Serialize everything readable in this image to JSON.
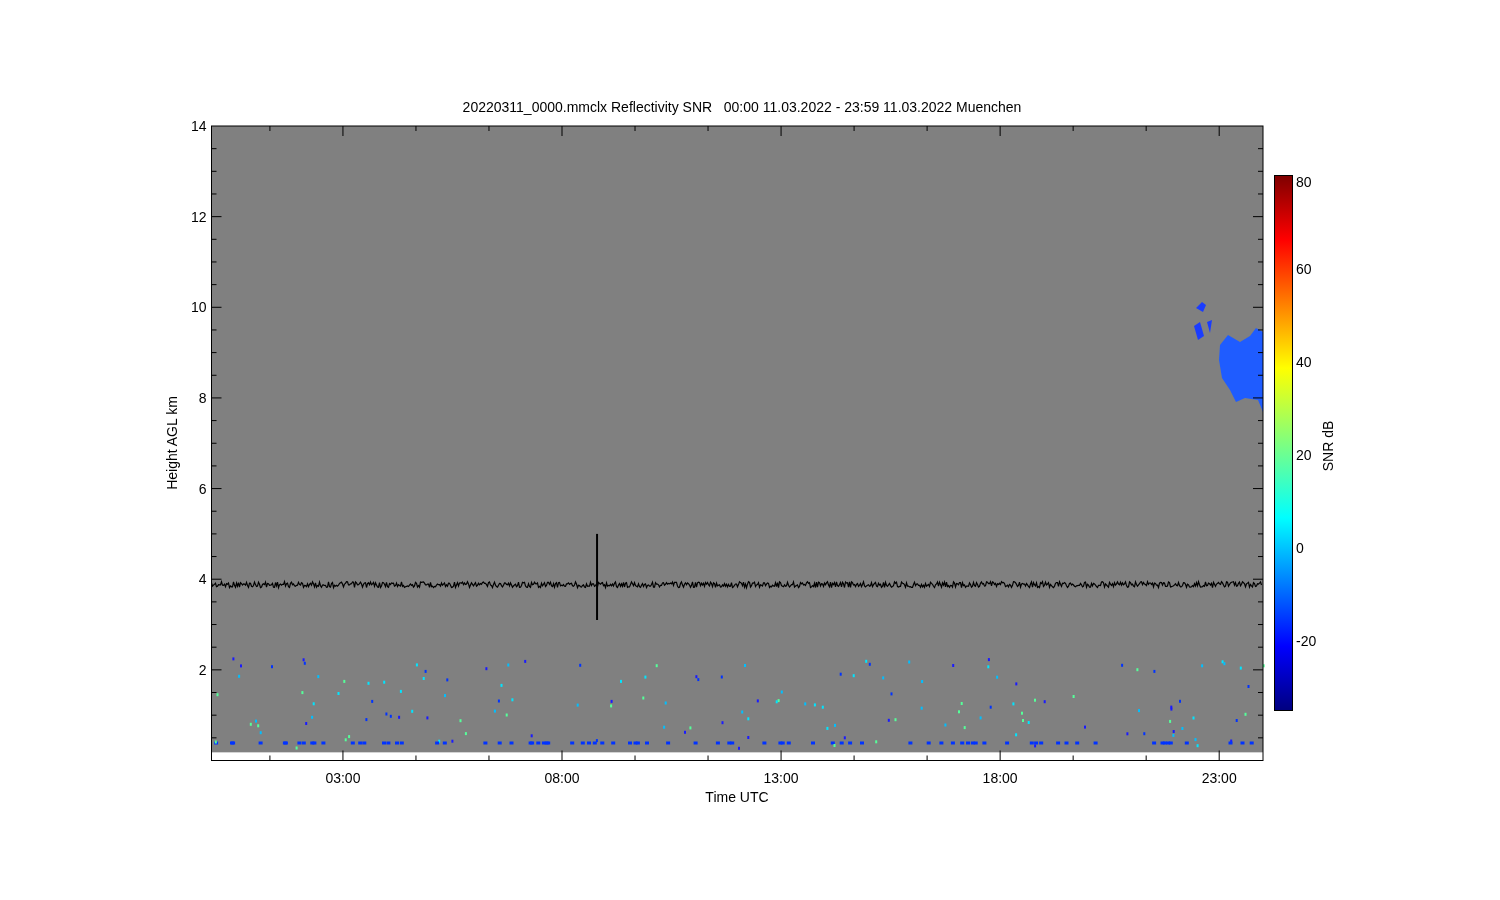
{
  "title": "20220311_0000.mmclx Reflectivity SNR   00:00 11.03.2022 - 23:59 11.03.2022 Muenchen",
  "plot": {
    "ylabel": "Height AGL km",
    "yticks": [
      "14",
      "12",
      "10",
      "8",
      "6",
      "4",
      "2"
    ],
    "xlabel": "Time UTC",
    "xticks": [
      "03:00",
      "08:00",
      "13:00",
      "18:00",
      "23:00"
    ]
  },
  "colorbar": {
    "label": "SNR dB",
    "ticks": [
      "80",
      "60",
      "40",
      "20",
      "0",
      "-20"
    ]
  }
}
